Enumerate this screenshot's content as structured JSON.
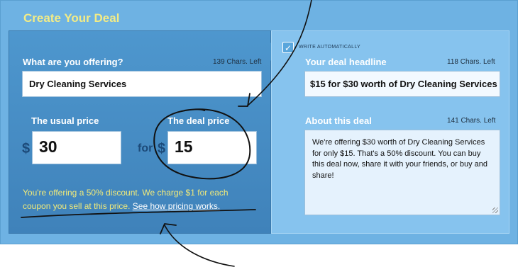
{
  "card": {
    "title": "Create Your Deal"
  },
  "offering": {
    "label": "What are you offering?",
    "chars_left": "139 Chars. Left",
    "value": "Dry Cleaning Services"
  },
  "usual_price": {
    "label": "The usual price",
    "currency": "$",
    "value": "30"
  },
  "connector": "for",
  "deal_price": {
    "label": "The deal price",
    "currency": "$",
    "value": "15"
  },
  "notice": {
    "text": "You're offering a 50% discount. We charge $1 for each coupon you sell at this price.",
    "link": "See how pricing works."
  },
  "auto": {
    "label": "WRITE AUTOMATICALLY",
    "checked": true
  },
  "headline": {
    "label": "Your deal headline",
    "chars_left": "118 Chars. Left",
    "value": "$15 for $30 worth of Dry Cleaning Services"
  },
  "about": {
    "label": "About this deal",
    "chars_left": "141 Chars. Left",
    "value": "We're offering $30 worth of Dry Cleaning Services for only $15. That's a 50% discount. You can buy this deal now, share it with your friends, or buy and share!"
  },
  "colors": {
    "card_bg": "#6eb2e3",
    "left_panel": "#4892c9",
    "right_panel": "#86c3ee",
    "title_yellow": "#f3ec86",
    "notice_yellow": "#f1ea7a"
  },
  "icons": {
    "checkbox": "checkmark-icon",
    "resize": "resize-grip-icon"
  }
}
